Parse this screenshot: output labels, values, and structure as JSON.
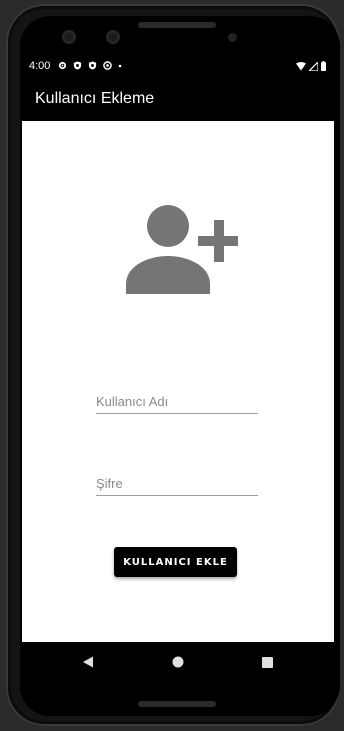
{
  "status_bar": {
    "time": "4:00",
    "icons": [
      "settings-icon",
      "shield-icon",
      "shield-icon",
      "vpn-icon",
      "dot-icon"
    ],
    "right_icons": [
      "wifi-icon",
      "signal-icon",
      "battery-icon"
    ]
  },
  "app_bar": {
    "title": "Kullanıcı Ekleme"
  },
  "form": {
    "hero_icon": "person-add-icon",
    "username": {
      "placeholder": "Kullanıcı Adı",
      "value": ""
    },
    "password": {
      "placeholder": "Şifre",
      "value": ""
    },
    "submit_label": "KULLANICI EKLE"
  },
  "nav_bar": {
    "buttons": [
      "back-icon",
      "home-icon",
      "recents-icon"
    ]
  },
  "colors": {
    "app_bar_bg": "#000000",
    "icon_gray": "#757575",
    "button_bg": "#000000",
    "screen_bg": "#ffffff"
  }
}
